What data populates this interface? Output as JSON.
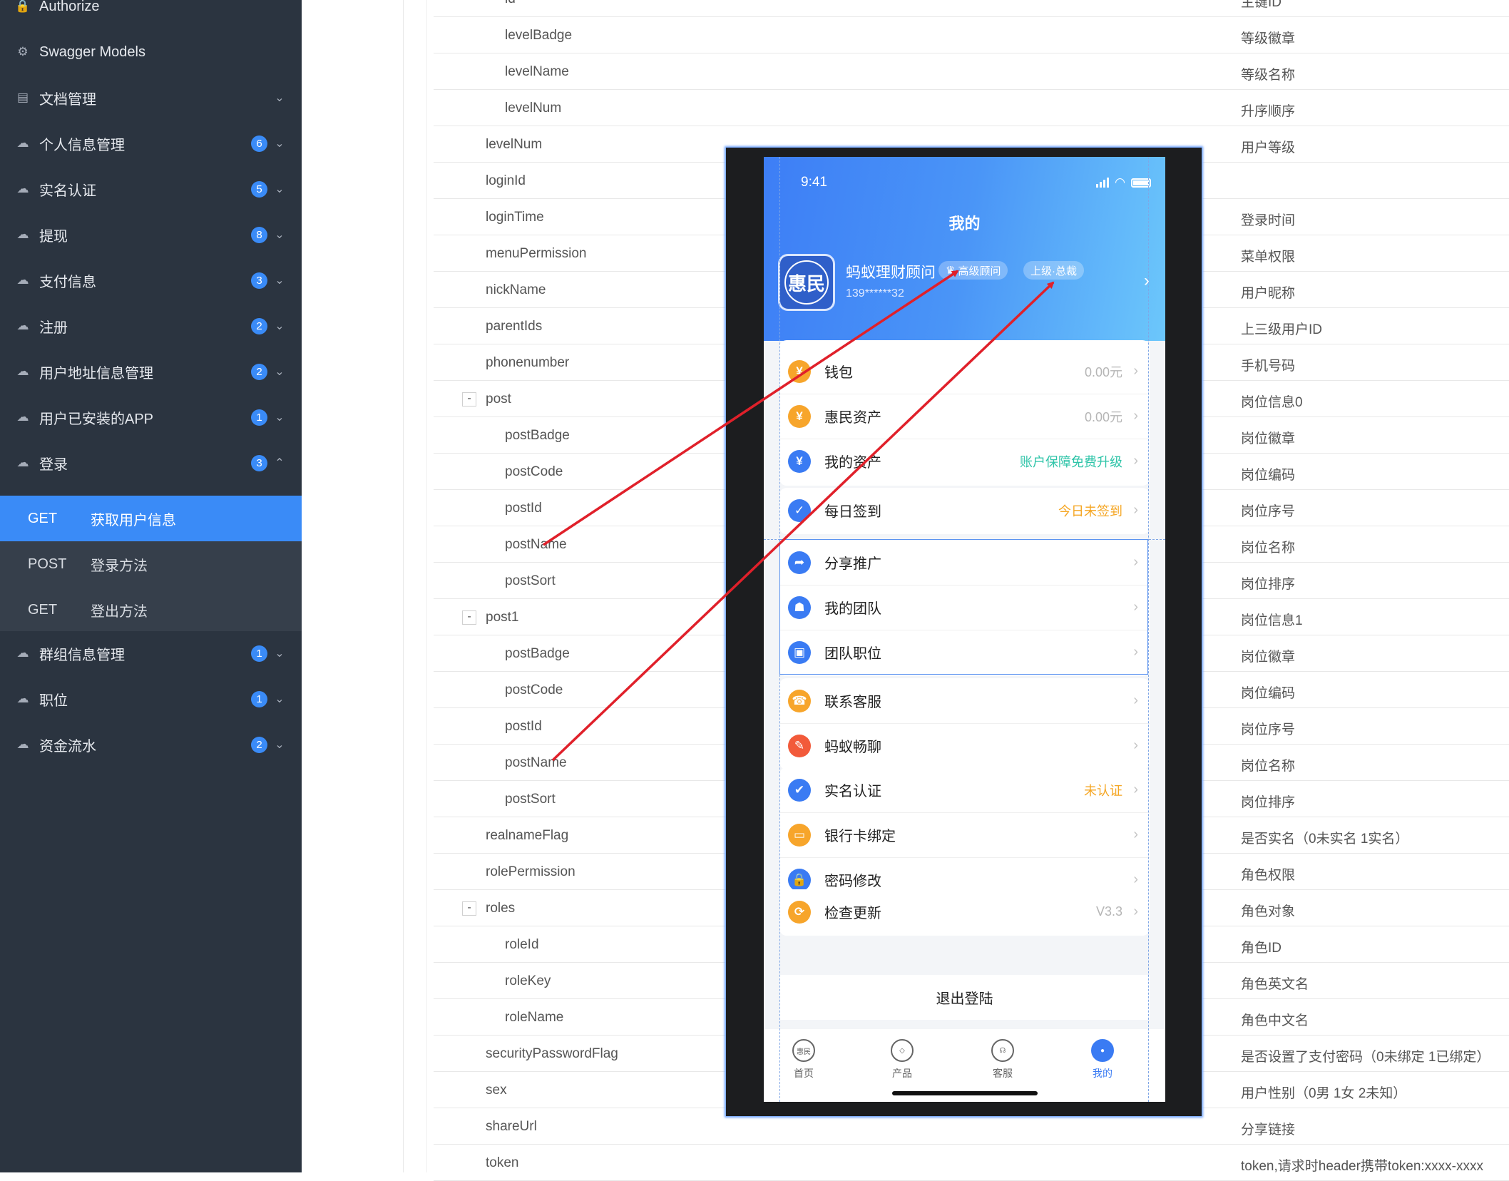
{
  "sidebar": {
    "items": [
      {
        "label": "Authorize",
        "badge": "",
        "icon": "lock-icon",
        "chevron": ""
      },
      {
        "label": "Swagger Models",
        "badge": "",
        "icon": "gear-icon",
        "chevron": ""
      },
      {
        "label": "文档管理",
        "badge": "",
        "icon": "document-icon",
        "chevron": "⌄"
      },
      {
        "label": "个人信息管理",
        "badge": "6",
        "icon": "cloud-icon",
        "chevron": "⌄"
      },
      {
        "label": "实名认证",
        "badge": "5",
        "icon": "cloud-icon",
        "chevron": "⌄"
      },
      {
        "label": "提现",
        "badge": "8",
        "icon": "cloud-icon",
        "chevron": "⌄"
      },
      {
        "label": "支付信息",
        "badge": "3",
        "icon": "cloud-icon",
        "chevron": "⌄"
      },
      {
        "label": "注册",
        "badge": "2",
        "icon": "cloud-icon",
        "chevron": "⌄"
      },
      {
        "label": "用户地址信息管理",
        "badge": "2",
        "icon": "cloud-icon",
        "chevron": "⌄"
      },
      {
        "label": "用户已安装的APP",
        "badge": "1",
        "icon": "cloud-icon",
        "chevron": "⌄"
      },
      {
        "label": "登录",
        "badge": "3",
        "icon": "cloud-icon",
        "chevron": "⌃"
      },
      {
        "label": "群组信息管理",
        "badge": "1",
        "icon": "cloud-icon",
        "chevron": "⌄"
      },
      {
        "label": "职位",
        "badge": "1",
        "icon": "cloud-icon",
        "chevron": "⌄"
      },
      {
        "label": "资金流水",
        "badge": "2",
        "icon": "cloud-icon",
        "chevron": "⌄"
      }
    ],
    "submenu": [
      {
        "method": "GET",
        "title": "获取用户信息",
        "active": true
      },
      {
        "method": "POST",
        "title": "登录方法",
        "active": false
      },
      {
        "method": "GET",
        "title": "登出方法",
        "active": false
      }
    ]
  },
  "table": {
    "rows": [
      {
        "name": "id",
        "desc": "主键ID",
        "indent": 2,
        "toggle": ""
      },
      {
        "name": "levelBadge",
        "desc": "等级徽章",
        "indent": 2,
        "toggle": ""
      },
      {
        "name": "levelName",
        "desc": "等级名称",
        "indent": 2,
        "toggle": ""
      },
      {
        "name": "levelNum",
        "desc": "升序顺序",
        "indent": 2,
        "toggle": ""
      },
      {
        "name": "levelNum",
        "desc": "用户等级",
        "indent": 1,
        "toggle": ""
      },
      {
        "name": "loginId",
        "desc": "",
        "indent": 1,
        "toggle": ""
      },
      {
        "name": "loginTime",
        "desc": "登录时间",
        "indent": 1,
        "toggle": ""
      },
      {
        "name": "menuPermission",
        "desc": "菜单权限",
        "indent": 1,
        "toggle": ""
      },
      {
        "name": "nickName",
        "desc": "用户昵称",
        "indent": 1,
        "toggle": ""
      },
      {
        "name": "parentIds",
        "desc": "上三级用户ID",
        "indent": 1,
        "toggle": ""
      },
      {
        "name": "phonenumber",
        "desc": "手机号码",
        "indent": 1,
        "toggle": ""
      },
      {
        "name": "post",
        "desc": "岗位信息0",
        "indent": 1,
        "toggle": "-"
      },
      {
        "name": "postBadge",
        "desc": "岗位徽章",
        "indent": 2,
        "toggle": ""
      },
      {
        "name": "postCode",
        "desc": "岗位编码",
        "indent": 2,
        "toggle": ""
      },
      {
        "name": "postId",
        "desc": "岗位序号",
        "indent": 2,
        "toggle": ""
      },
      {
        "name": "postName",
        "desc": "岗位名称",
        "indent": 2,
        "toggle": ""
      },
      {
        "name": "postSort",
        "desc": "岗位排序",
        "indent": 2,
        "toggle": ""
      },
      {
        "name": "post1",
        "desc": "岗位信息1",
        "indent": 1,
        "toggle": "-"
      },
      {
        "name": "postBadge",
        "desc": "岗位徽章",
        "indent": 2,
        "toggle": ""
      },
      {
        "name": "postCode",
        "desc": "岗位编码",
        "indent": 2,
        "toggle": ""
      },
      {
        "name": "postId",
        "desc": "岗位序号",
        "indent": 2,
        "toggle": ""
      },
      {
        "name": "postName",
        "desc": "岗位名称",
        "indent": 2,
        "toggle": ""
      },
      {
        "name": "postSort",
        "desc": "岗位排序",
        "indent": 2,
        "toggle": ""
      },
      {
        "name": "realnameFlag",
        "desc": "是否实名（0未实名 1实名）",
        "indent": 1,
        "toggle": ""
      },
      {
        "name": "rolePermission",
        "desc": "角色权限",
        "indent": 1,
        "toggle": ""
      },
      {
        "name": "roles",
        "desc": "角色对象",
        "indent": 1,
        "toggle": "-"
      },
      {
        "name": "roleId",
        "desc": "角色ID",
        "indent": 2,
        "toggle": ""
      },
      {
        "name": "roleKey",
        "desc": "角色英文名",
        "indent": 2,
        "toggle": ""
      },
      {
        "name": "roleName",
        "desc": "角色中文名",
        "indent": 2,
        "toggle": ""
      },
      {
        "name": "securityPasswordFlag",
        "desc": "是否设置了支付密码（0未绑定 1已绑定）",
        "indent": 1,
        "toggle": ""
      },
      {
        "name": "sex",
        "desc": "用户性别（0男 1女 2未知）",
        "indent": 1,
        "toggle": ""
      },
      {
        "name": "shareUrl",
        "desc": "分享链接",
        "indent": 1,
        "toggle": ""
      },
      {
        "name": "token",
        "desc": "token,请求时header携带token:xxxx-xxxx",
        "indent": 1,
        "toggle": ""
      }
    ]
  },
  "phone": {
    "time": "9:41",
    "title": "我的",
    "logo_text": "惠民",
    "user_name": "蚂蚁理财顾问",
    "tag_level": "高级顾问",
    "tag_superior": "上级·总裁",
    "phone_masked": "139******32",
    "groups": [
      [
        {
          "label": "钱包",
          "value": "0.00元",
          "value_color": "#b5b5b5",
          "icon_color": "#f7a52b",
          "icon_glyph": "¥",
          "icon": "wallet-icon"
        },
        {
          "label": "惠民资产",
          "value": "0.00元",
          "value_color": "#b5b5b5",
          "icon_color": "#f7a52b",
          "icon_glyph": "¥",
          "icon": "assets-icon"
        },
        {
          "label": "我的资产",
          "value": "账户保障免费升级",
          "value_color": "#2ec4a8",
          "icon_color": "#3a7bf3",
          "icon_glyph": "¥",
          "icon": "money-bag-icon"
        }
      ],
      [
        {
          "label": "每日签到",
          "value": "今日未签到",
          "value_color": "#f5a623",
          "icon_color": "#3a7bf3",
          "icon_glyph": "✓",
          "icon": "calendar-check-icon"
        }
      ],
      [
        {
          "label": "分享推广",
          "value": "",
          "value_color": "#b5b5b5",
          "icon_color": "#3a7bf3",
          "icon_glyph": "➦",
          "icon": "share-icon"
        },
        {
          "label": "我的团队",
          "value": "",
          "value_color": "#b5b5b5",
          "icon_color": "#3a7bf3",
          "icon_glyph": "☗",
          "icon": "team-icon"
        },
        {
          "label": "团队职位",
          "value": "",
          "value_color": "#b5b5b5",
          "icon_color": "#3a7bf3",
          "icon_glyph": "▣",
          "icon": "briefcase-icon"
        }
      ],
      [
        {
          "label": "联系客服",
          "value": "",
          "value_color": "#b5b5b5",
          "icon_color": "#f7a52b",
          "icon_glyph": "☎",
          "icon": "headset-icon"
        },
        {
          "label": "蚂蚁畅聊",
          "value": "",
          "value_color": "#b5b5b5",
          "icon_color": "#f25a3a",
          "icon_glyph": "✎",
          "icon": "chat-icon"
        }
      ],
      [
        {
          "label": "实名认证",
          "value": "未认证",
          "value_color": "#f5a623",
          "icon_color": "#3a7bf3",
          "icon_glyph": "✔",
          "icon": "verified-icon"
        },
        {
          "label": "银行卡绑定",
          "value": "",
          "value_color": "#b5b5b5",
          "icon_color": "#f7a52b",
          "icon_glyph": "▭",
          "icon": "bank-card-icon"
        },
        {
          "label": "密码修改",
          "value": "",
          "value_color": "#b5b5b5",
          "icon_color": "#3a7bf3",
          "icon_glyph": "🔒",
          "icon": "lock-icon"
        }
      ],
      [
        {
          "label": "检查更新",
          "value": "V3.3",
          "value_color": "#b5b5b5",
          "icon_color": "#f7a52b",
          "icon_glyph": "⟳",
          "icon": "refresh-icon"
        }
      ]
    ],
    "logout": "退出登陆",
    "tabs": [
      {
        "label": "首页",
        "glyph": "惠民",
        "active": false,
        "icon": "home-logo-icon"
      },
      {
        "label": "产品",
        "glyph": "◇",
        "active": false,
        "icon": "cube-icon"
      },
      {
        "label": "客服",
        "glyph": "☊",
        "active": false,
        "icon": "headset-icon"
      },
      {
        "label": "我的",
        "glyph": "●",
        "active": true,
        "icon": "user-icon"
      }
    ]
  },
  "colors": {
    "sidebar_bg": "#2b3440",
    "accent": "#3a8bf7",
    "arrow": "#e0202a"
  }
}
